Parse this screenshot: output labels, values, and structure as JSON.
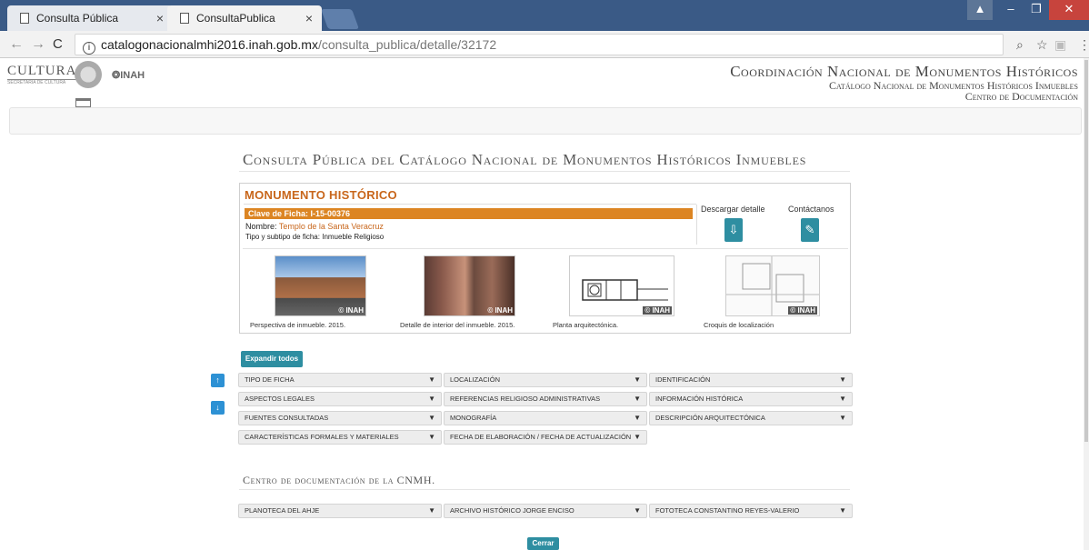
{
  "browser": {
    "tabs": [
      {
        "title": "Consulta Pública"
      },
      {
        "title": "ConsultaPublica"
      }
    ],
    "url_host": "catalogonacionalmhi2016.inah.gob.mx",
    "url_path": "/consulta_publica/detalle/32172"
  },
  "header": {
    "cultura": "CULTURA",
    "cultura_sub": "SECRETARÍA DE CULTURA",
    "inah": "INAH",
    "coord_l1": "Coordinación Nacional de Monumentos Históricos",
    "coord_l2": "Catálogo Nacional de Monumentos Históricos Inmuebles",
    "coord_l3": "Centro de Documentación"
  },
  "page_title": "Consulta Pública del Catálogo Nacional de Monumentos Históricos Inmuebles",
  "monument": {
    "heading": "MONUMENTO HISTÓRICO",
    "clave": "Clave de Ficha: I-15-00376",
    "nombre_label": "Nombre:",
    "nombre_value": "Templo de la Santa Veracruz",
    "tipo_label": "Tipo y subtipo de ficha:",
    "tipo_value": "Inmueble Religioso",
    "descargar": "Descargar detalle",
    "contactanos": "Contáctanos",
    "watermark": "© INAH",
    "photos": [
      {
        "caption": "Perspectiva de inmueble. 2015."
      },
      {
        "caption": "Detalle de interior del inmueble. 2015."
      },
      {
        "caption": "Planta arquitectónica."
      },
      {
        "caption": "Croquis de localización"
      }
    ]
  },
  "expand_all": "Expandir todos",
  "sections": [
    [
      "TIPO DE FICHA",
      "LOCALIZACIÓN",
      "IDENTIFICACIÓN"
    ],
    [
      "ASPECTOS LEGALES",
      "REFERENCIAS RELIGIOSO ADMINISTRATIVAS",
      "INFORMACIÓN HISTÓRICA"
    ],
    [
      "FUENTES CONSULTADAS",
      "MONOGRAFÍA",
      "DESCRIPCIÓN ARQUITECTÓNICA"
    ],
    [
      "CARACTERÍSTICAS FORMALES Y MATERIALES",
      "FECHA DE ELABORACIÓN / FECHA DE ACTUALIZACIÓN"
    ]
  ],
  "doc_center_title": "Centro de documentación de la CNMH.",
  "doc_sections": [
    "PLANOTECA DEL AHJE",
    "ARCHIVO HISTÓRICO JORGE ENCISO",
    "FOTOTECA CONSTANTINO REYES-VALERIO"
  ],
  "close": "Cerrar",
  "colors": {
    "accent_orange": "#dc8523",
    "teal": "#2e8ea1",
    "side_blue": "#2d91d4"
  }
}
